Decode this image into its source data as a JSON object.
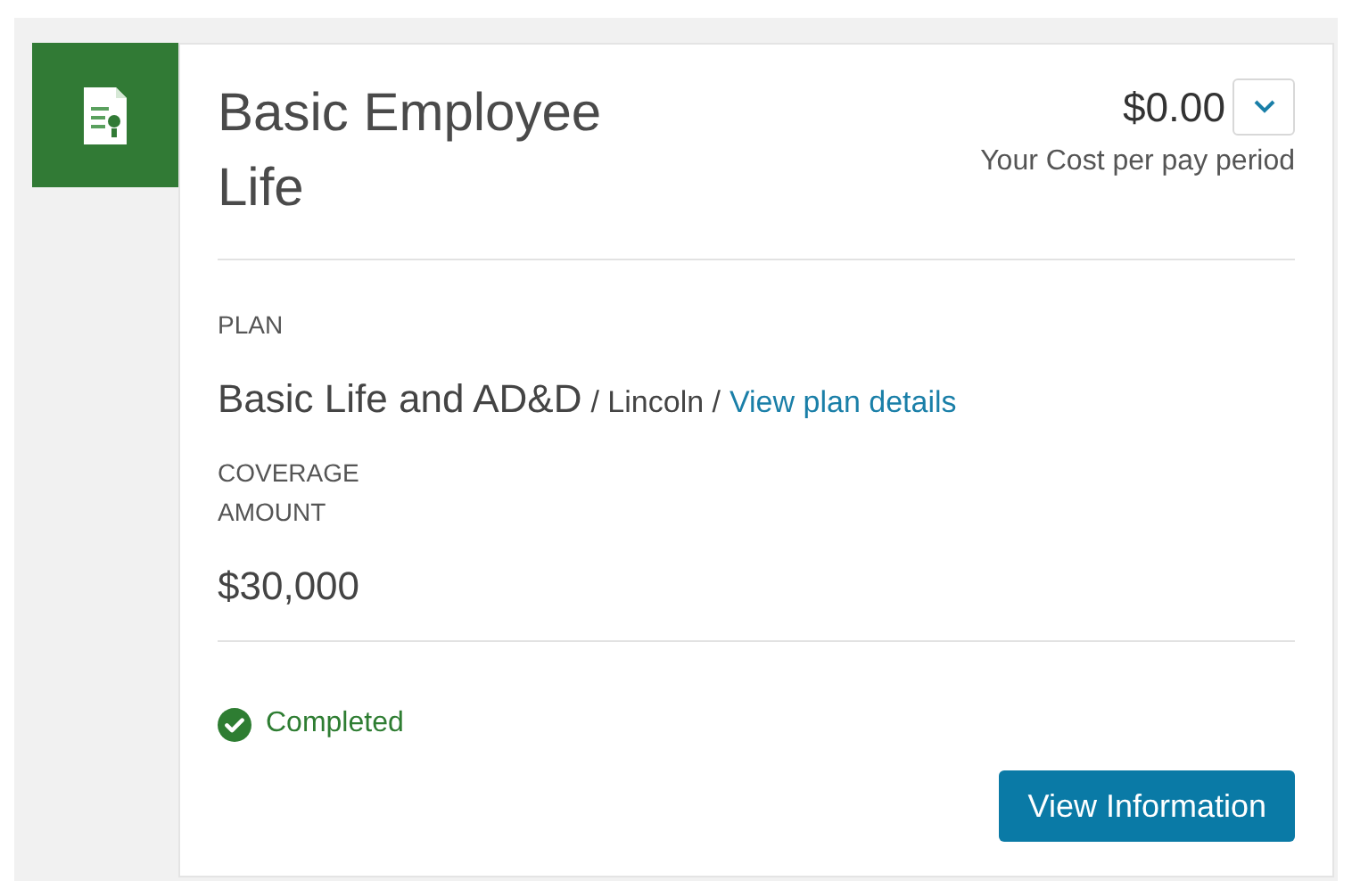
{
  "card": {
    "title": "Basic Employee Life",
    "cost": "$0.00",
    "cost_caption": "Your Cost per pay period",
    "details_toggle": {
      "expanded": false
    },
    "plan": {
      "label": "PLAN",
      "name": "Basic Life and AD&D",
      "carrier": "/ Lincoln /",
      "link": "View plan details"
    },
    "coverage": {
      "label": "COVERAGE AMOUNT",
      "value": "$30,000"
    },
    "status": {
      "kind": "completed",
      "label": "Completed"
    },
    "action": "View Information"
  }
}
